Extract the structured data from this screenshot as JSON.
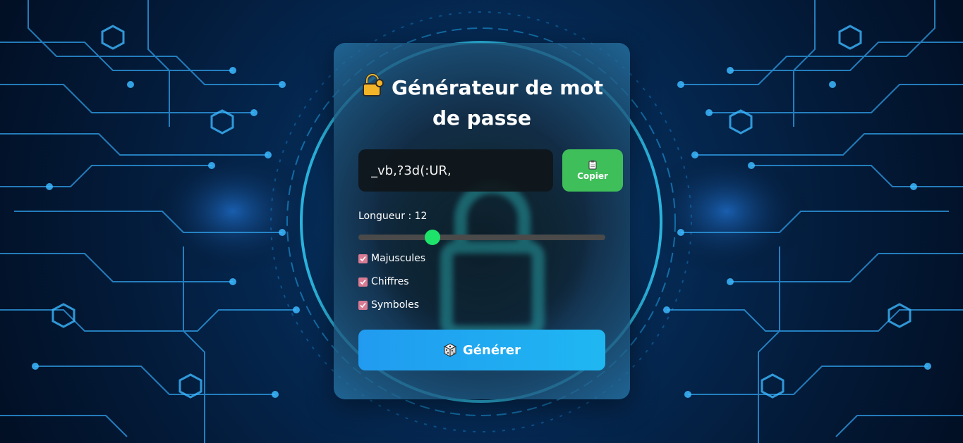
{
  "colors": {
    "background": "#04244a",
    "card": "#1e3c50",
    "copy_button": "#3fbf5a",
    "slider_thumb": "#1ee36b",
    "slider_track": "#4a4a4a",
    "checkbox": "#d97b93",
    "generate_button": "#219bf0"
  },
  "app": {
    "title": "Générateur de mot de passe",
    "title_icon": "lock-emoji"
  },
  "password": {
    "value": "_vb,?3d(:UR,"
  },
  "copy_button": {
    "label": "Copier",
    "icon": "clipboard-icon"
  },
  "length": {
    "label": "Longueur : 12",
    "value": 12,
    "min": 4,
    "max": 32
  },
  "options": [
    {
      "label": "Majuscules",
      "checked": true
    },
    {
      "label": "Chiffres",
      "checked": true
    },
    {
      "label": "Symboles",
      "checked": true
    }
  ],
  "generate_button": {
    "label": "Générer",
    "icon": "dice-icon"
  }
}
